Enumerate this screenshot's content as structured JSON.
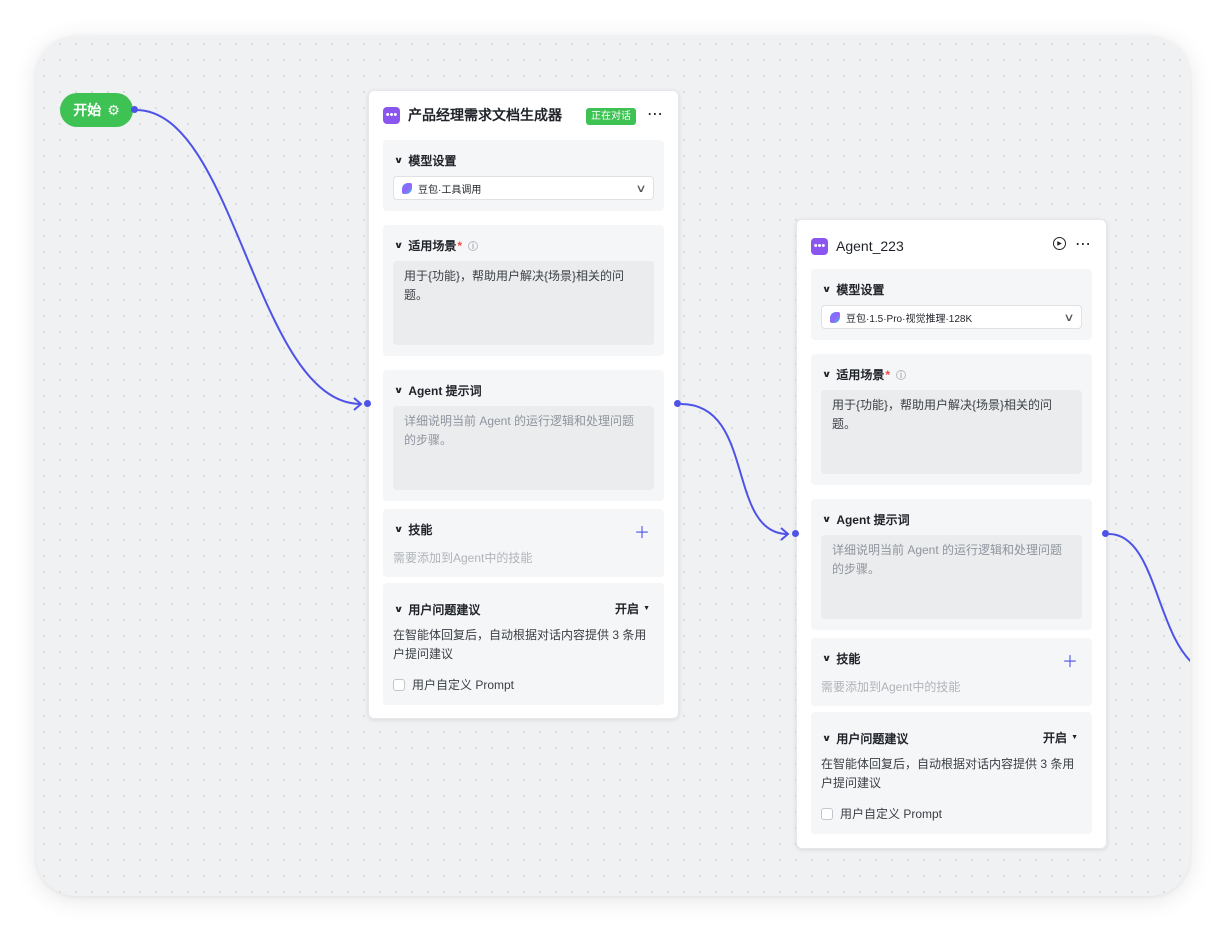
{
  "start_node": {
    "label": "开始",
    "icon": "gear-icon"
  },
  "colors": {
    "edge": "#4d53e8",
    "start": "#3ec254",
    "agent_icon": "#8b55f0",
    "required": "#f54a45",
    "plus": "#4d53e8"
  },
  "cards": [
    {
      "title": "产品经理需求文档生成器",
      "status": "正在对话",
      "model_section": {
        "label": "模型设置",
        "model": "豆包·工具调用"
      },
      "scene_section": {
        "label": "适用场景",
        "required": "*",
        "value": "用于{功能}，帮助用户解决{场景}相关的问题。"
      },
      "prompt_section": {
        "label": "Agent 提示词",
        "placeholder": "详细说明当前 Agent 的运行逻辑和处理问题的步骤。"
      },
      "skills_section": {
        "label": "技能",
        "desc": "需要添加到Agent中的技能"
      },
      "suggest_section": {
        "label": "用户问题建议",
        "toggle": "开启",
        "desc": "在智能体回复后，自动根据对话内容提供 3 条用户提问建议",
        "checkbox_label": "用户自定义 Prompt"
      }
    },
    {
      "title": "Agent_223",
      "model_section": {
        "label": "模型设置",
        "model": "豆包·1.5·Pro·视觉推理·128K"
      },
      "scene_section": {
        "label": "适用场景",
        "required": "*",
        "value": "用于{功能}，帮助用户解决{场景}相关的问题。"
      },
      "prompt_section": {
        "label": "Agent 提示词",
        "placeholder": "详细说明当前 Agent 的运行逻辑和处理问题的步骤。"
      },
      "skills_section": {
        "label": "技能",
        "desc": "需要添加到Agent中的技能"
      },
      "suggest_section": {
        "label": "用户问题建议",
        "toggle": "开启",
        "desc": "在智能体回复后，自动根据对话内容提供 3 条用户提问建议",
        "checkbox_label": "用户自定义 Prompt"
      }
    }
  ]
}
